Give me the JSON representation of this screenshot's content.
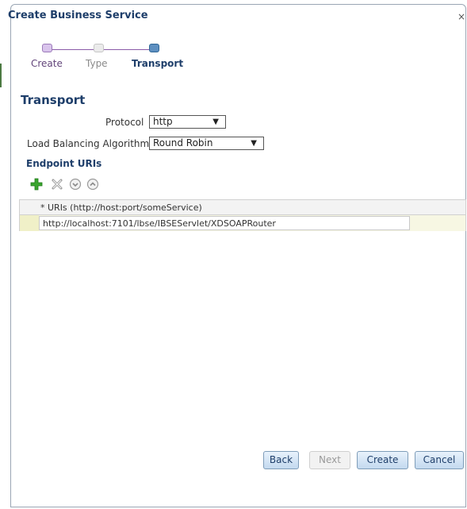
{
  "dialog": {
    "title": "Create Business Service",
    "close_label": "×"
  },
  "train": {
    "steps": [
      {
        "label": "Create",
        "state": "visited"
      },
      {
        "label": "Type",
        "state": "unvisited"
      },
      {
        "label": "Transport",
        "state": "current"
      }
    ]
  },
  "transport": {
    "section_title": "Transport",
    "protocol_label": "Protocol",
    "protocol_value": "http",
    "lb_label": "Load Balancing Algorithm",
    "lb_value": "Round Robin"
  },
  "endpoints": {
    "title": "Endpoint URIs",
    "toolbar": [
      "add-icon",
      "delete-icon",
      "move-down-icon",
      "move-up-icon"
    ],
    "column_header": "* URIs (http://host:port/someService)",
    "rows": [
      {
        "uri": "http://localhost:7101/lbse/IBSEServlet/XDSOAPRouter"
      }
    ]
  },
  "footer": {
    "back": "Back",
    "next": "Next",
    "create": "Create",
    "cancel": "Cancel"
  },
  "colors": {
    "title": "#1e3e6a",
    "add_icon": "#3aa52e",
    "visited_step": "#8a5aa8",
    "current_step": "#5d8fc0"
  }
}
